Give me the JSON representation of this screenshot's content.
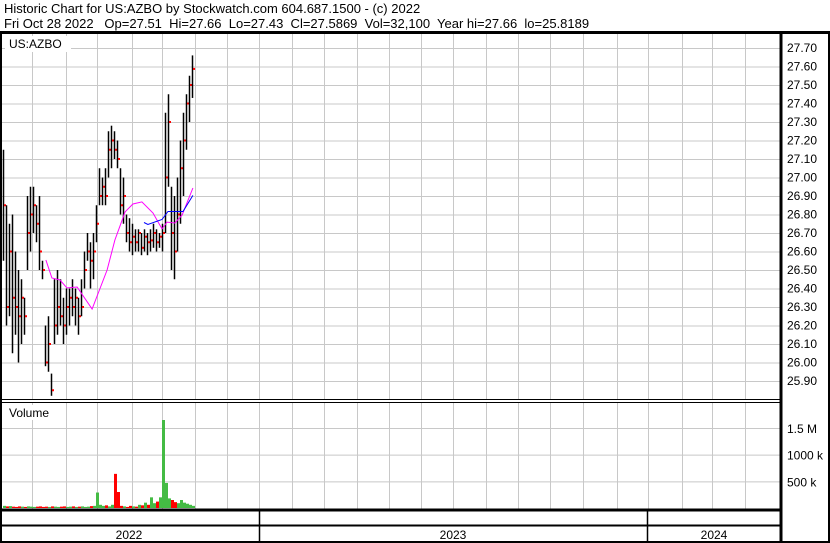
{
  "header": {
    "title": "Historic Chart for US:AZBO by Stockwatch.com 604.687.1500 - (c) 2022",
    "quote": "Fri Oct 28 2022   Op=27.51  Hi=27.66  Lo=27.43  Cl=27.5869  Vol=32,100  Year hi=27.66  lo=25.8189"
  },
  "chart_data": {
    "type": "ohlc",
    "symbol": "US:AZBO",
    "volume_label": "Volume",
    "price_ticks": [
      "27.70",
      "27.60",
      "27.50",
      "27.40",
      "27.30",
      "27.20",
      "27.10",
      "27.00",
      "26.90",
      "26.80",
      "26.70",
      "26.60",
      "26.50",
      "26.40",
      "26.30",
      "26.20",
      "26.10",
      "26.00",
      "25.90"
    ],
    "price_range": [
      25.82,
      27.78
    ],
    "volume_ticks": [
      {
        "label": "1.5 M",
        "value": 1500
      },
      {
        "label": "1000 k",
        "value": 1000
      },
      {
        "label": "500 k",
        "value": 500
      }
    ],
    "volume_unit": "k",
    "years": [
      "2022",
      "2023",
      "2024"
    ],
    "bars_hlc": [
      [
        27.15,
        26.55,
        26.85
      ],
      [
        26.85,
        26.2,
        26.3
      ],
      [
        26.75,
        26.25,
        26.6
      ],
      [
        26.8,
        26.05,
        26.35
      ],
      [
        26.6,
        26.15,
        26.3
      ],
      [
        26.5,
        26.0,
        26.25
      ],
      [
        26.45,
        26.1,
        26.35
      ],
      [
        26.35,
        26.15,
        26.25
      ],
      [
        26.9,
        26.5,
        26.7
      ],
      [
        26.95,
        26.6,
        26.8
      ],
      [
        26.95,
        26.7,
        26.85
      ],
      [
        26.85,
        26.65,
        26.75
      ],
      [
        26.9,
        26.5,
        26.6
      ],
      [
        26.55,
        26.45,
        26.5
      ],
      [
        26.2,
        25.98,
        26.0
      ],
      [
        26.25,
        25.95,
        26.1
      ],
      [
        25.94,
        25.82,
        25.85
      ],
      [
        26.45,
        26.1,
        26.2
      ],
      [
        26.5,
        26.15,
        26.3
      ],
      [
        26.45,
        26.2,
        26.25
      ],
      [
        26.35,
        26.1,
        26.2
      ],
      [
        26.4,
        26.15,
        26.3
      ],
      [
        26.4,
        26.2,
        26.35
      ],
      [
        26.45,
        26.25,
        26.3
      ],
      [
        26.4,
        26.2,
        26.35
      ],
      [
        26.35,
        26.15,
        26.25
      ],
      [
        26.45,
        26.25,
        26.3
      ],
      [
        26.6,
        26.4,
        26.5
      ],
      [
        26.7,
        26.55,
        26.6
      ],
      [
        26.65,
        26.4,
        26.55
      ],
      [
        26.7,
        26.45,
        26.6
      ],
      [
        26.85,
        26.65,
        26.75
      ],
      [
        27.05,
        26.85,
        26.9
      ],
      [
        27.0,
        26.85,
        26.95
      ],
      [
        27.05,
        26.85,
        26.9
      ],
      [
        27.25,
        27.0,
        27.15
      ],
      [
        27.28,
        27.05,
        27.2
      ],
      [
        27.25,
        27.1,
        27.15
      ],
      [
        27.2,
        27.05,
        27.1
      ],
      [
        27.05,
        26.8,
        26.85
      ],
      [
        27.0,
        26.75,
        26.9
      ],
      [
        26.8,
        26.65,
        26.7
      ],
      [
        26.78,
        26.6,
        26.65
      ],
      [
        26.75,
        26.58,
        26.68
      ],
      [
        26.72,
        26.6,
        26.65
      ],
      [
        26.72,
        26.6,
        26.7
      ],
      [
        26.7,
        26.58,
        26.62
      ],
      [
        26.72,
        26.6,
        26.68
      ],
      [
        26.7,
        26.58,
        26.65
      ],
      [
        26.72,
        26.6,
        26.66
      ],
      [
        26.75,
        26.62,
        26.7
      ],
      [
        26.72,
        26.6,
        26.65
      ],
      [
        26.7,
        26.62,
        26.68
      ],
      [
        26.75,
        26.6,
        26.7
      ],
      [
        27.35,
        26.7,
        27.0
      ],
      [
        27.45,
        26.95,
        27.3
      ],
      [
        26.95,
        26.5,
        26.7
      ],
      [
        26.9,
        26.45,
        26.6
      ],
      [
        27.0,
        26.6,
        26.8
      ],
      [
        27.2,
        26.75,
        27.05
      ],
      [
        27.35,
        26.9,
        27.2
      ],
      [
        27.45,
        27.15,
        27.4
      ],
      [
        27.55,
        27.3,
        27.5
      ],
      [
        27.66,
        27.43,
        27.5869
      ]
    ],
    "volume": [
      40,
      30,
      35,
      25,
      20,
      30,
      25,
      20,
      30,
      25,
      20,
      25,
      30,
      20,
      25,
      20,
      30,
      25,
      20,
      25,
      30,
      20,
      25,
      30,
      20,
      25,
      30,
      20,
      25,
      35,
      40,
      290,
      60,
      40,
      50,
      30,
      60,
      640,
      300,
      40,
      30,
      20,
      40,
      30,
      25,
      60,
      50,
      100,
      60,
      200,
      90,
      120,
      200,
      1650,
      470,
      180,
      150,
      110,
      90,
      150,
      100,
      80,
      60,
      40
    ],
    "ma_long": [
      [
        14.3,
        26.554
      ],
      [
        16.3,
        26.457
      ],
      [
        19,
        26.446
      ],
      [
        21.3,
        26.403
      ],
      [
        24.7,
        26.408
      ],
      [
        29.7,
        26.289
      ],
      [
        34.7,
        26.5
      ],
      [
        37.3,
        26.662
      ],
      [
        40.7,
        26.814
      ],
      [
        43.3,
        26.857
      ],
      [
        46.3,
        26.868
      ],
      [
        50,
        26.808
      ],
      [
        53,
        26.722
      ],
      [
        54.7,
        26.759
      ],
      [
        57.3,
        26.754
      ],
      [
        59.7,
        26.797
      ],
      [
        63.3,
        26.943
      ]
    ],
    "ma_short": [
      [
        47,
        26.757
      ],
      [
        48.3,
        26.746
      ],
      [
        53,
        26.773
      ],
      [
        55,
        26.816
      ],
      [
        60,
        26.816
      ],
      [
        63.3,
        26.903
      ]
    ],
    "colors": {
      "bar": "#000000",
      "close_tick": "#ff0000",
      "ma_long": "#ff00ff",
      "ma_short": "#0000ff",
      "vol_up": "#44bb44",
      "vol_down": "#ff0000",
      "grid": "#c8c8c8"
    }
  }
}
